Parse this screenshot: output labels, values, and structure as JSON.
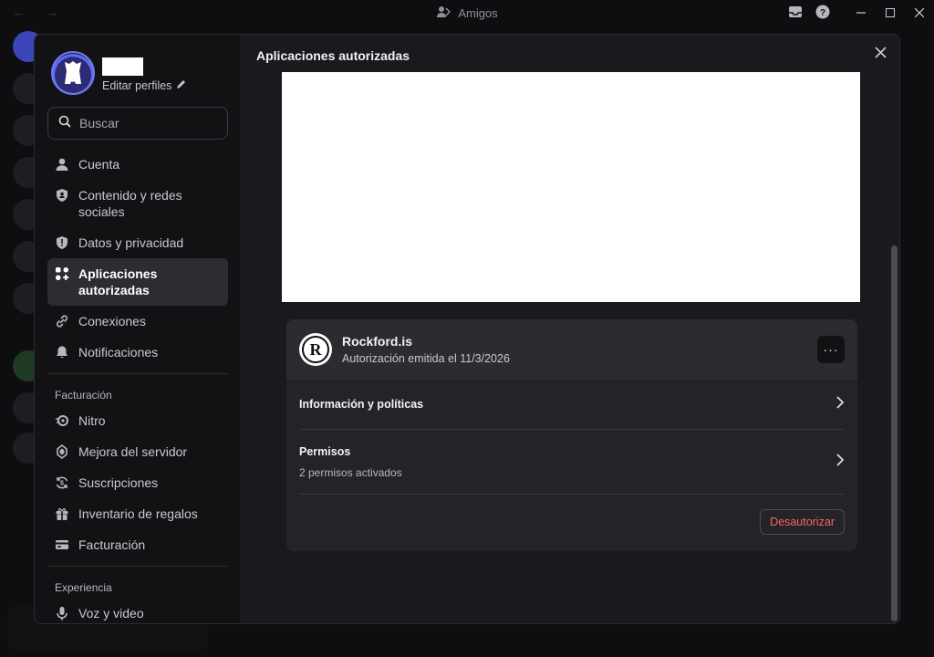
{
  "window": {
    "title": "Amigos",
    "nav_arrows": "← →"
  },
  "sidebar": {
    "edit_profiles": "Editar perfiles",
    "search_placeholder": "Buscar",
    "items": [
      {
        "label": "Cuenta",
        "icon": "user-icon"
      },
      {
        "label": "Contenido y redes sociales",
        "icon": "shield-user-icon"
      },
      {
        "label": "Datos y privacidad",
        "icon": "shield-icon"
      },
      {
        "label": "Aplicaciones autorizadas",
        "icon": "apps-icon",
        "active": true
      },
      {
        "label": "Conexiones",
        "icon": "link-icon"
      },
      {
        "label": "Notificaciones",
        "icon": "bell-icon"
      }
    ],
    "billing_header": "Facturación",
    "billing_items": [
      {
        "label": "Nitro",
        "icon": "nitro-icon"
      },
      {
        "label": "Mejora del servidor",
        "icon": "boost-icon"
      },
      {
        "label": "Suscripciones",
        "icon": "subscription-icon"
      },
      {
        "label": "Inventario de regalos",
        "icon": "gift-icon"
      },
      {
        "label": "Facturación",
        "icon": "credit-card-icon"
      }
    ],
    "experience_header": "Experiencia",
    "experience_items": [
      {
        "label": "Voz y video",
        "icon": "microphone-icon"
      }
    ]
  },
  "content": {
    "title": "Aplicaciones autorizadas",
    "app": {
      "name": "Rockford.is",
      "logo_letter": "R",
      "subtitle": "Autorización emitida el 11/3/2026",
      "more_label": "···",
      "rows": [
        {
          "title": "Información y políticas",
          "subtitle": ""
        },
        {
          "title": "Permisos",
          "subtitle": "2 permisos activados"
        }
      ],
      "deauthorize_label": "Desautorizar"
    }
  },
  "colors": {
    "danger": "#f0666b",
    "accent": "#5865f2"
  }
}
